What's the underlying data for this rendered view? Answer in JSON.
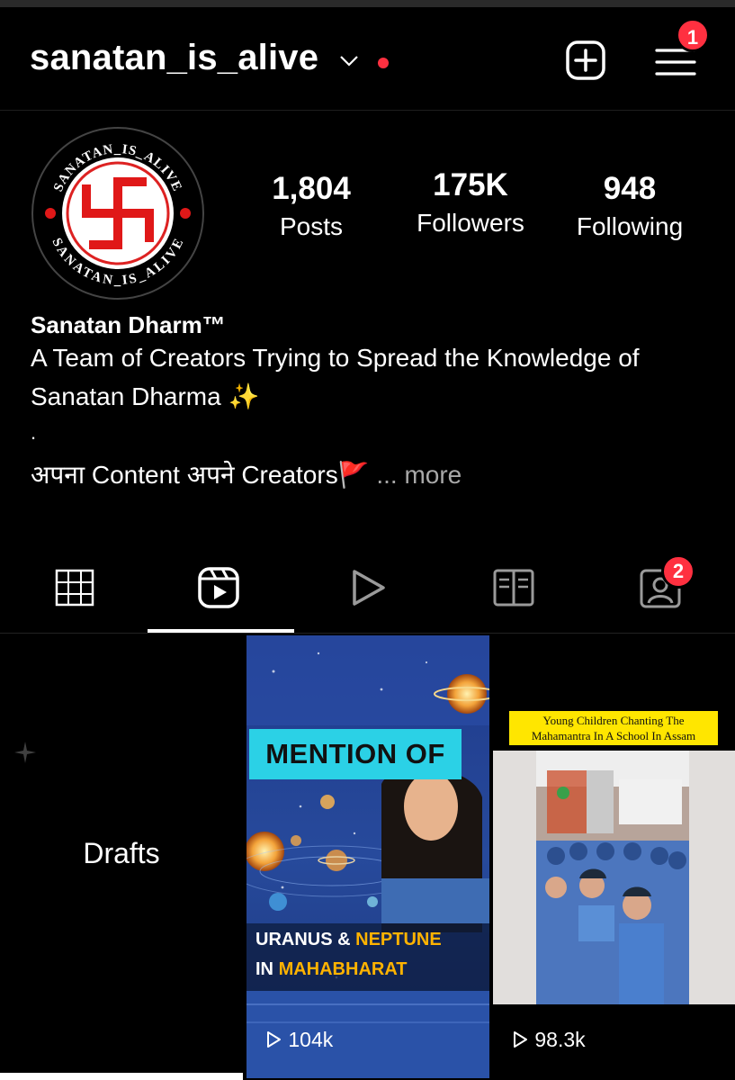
{
  "header": {
    "username": "sanatan_is_alive",
    "menu_badge": "1"
  },
  "avatar": {
    "ring_text_top": "SANATAN_IS_ALIVE",
    "ring_text_bottom": "SANATAN_IS_ALIVE"
  },
  "stats": {
    "posts": {
      "value": "1,804",
      "label": "Posts"
    },
    "followers": {
      "value": "175K",
      "label": "Followers"
    },
    "following": {
      "value": "948",
      "label": "Following"
    }
  },
  "bio": {
    "name": "Sanatan Dharm™",
    "line1": "A Team of Creators Trying to Spread the Knowledge of",
    "line2": "Sanatan Dharma ✨",
    "dot": ".",
    "line3": "अपना Content अपने Creators🚩",
    "more": " ... more"
  },
  "tabs": {
    "tagged_badge": "2"
  },
  "grid": {
    "drafts_label": "Drafts",
    "reel1": {
      "title_top": "MENTION OF",
      "title_line1_a": "URANUS & ",
      "title_line1_b": "NEPTUNE",
      "title_line2_a": "IN ",
      "title_line2_b": "MAHABHARAT",
      "views": "104k"
    },
    "reel2": {
      "caption_line1": "Young Children Chanting The ",
      "caption_line2": "Mahamantra In A School In Assam",
      "views": "98.3k"
    }
  },
  "colors": {
    "accent_red": "#ff3040",
    "banner_cyan": "#2bd1e6",
    "highlight_yellow": "#ffb300"
  }
}
